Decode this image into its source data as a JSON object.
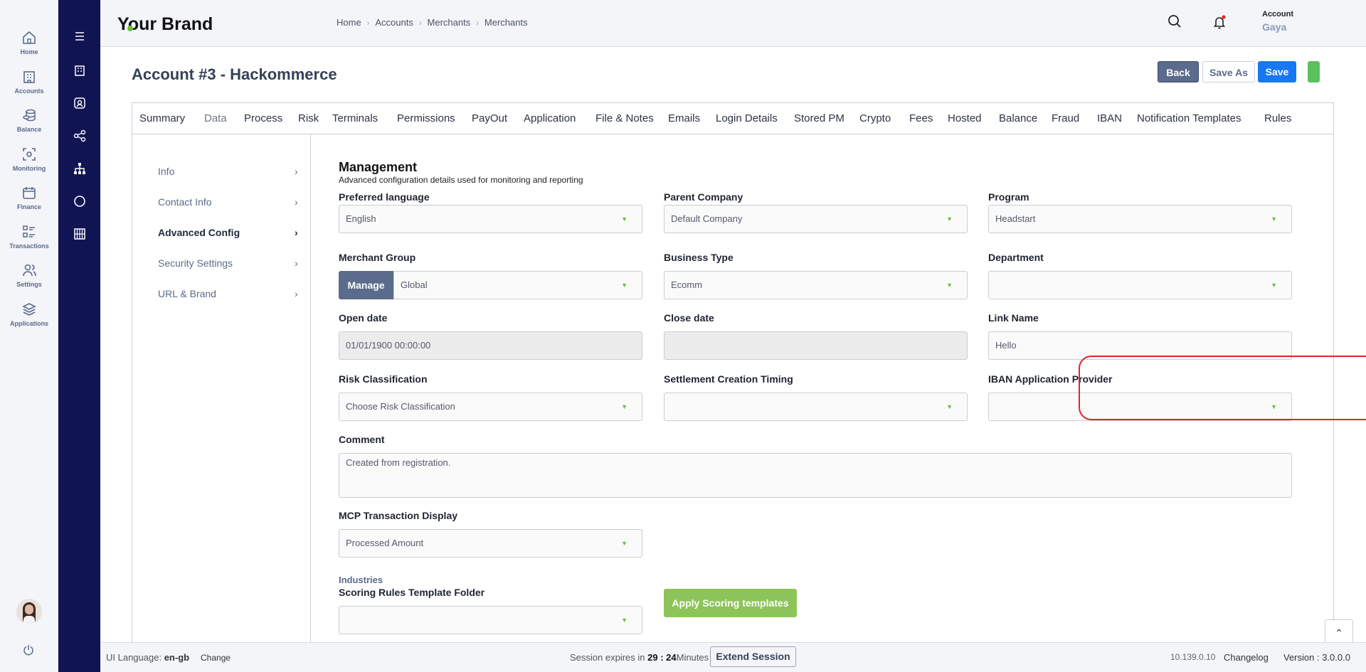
{
  "nav": {
    "items": [
      {
        "label": "Home",
        "icon": "home-icon"
      },
      {
        "label": "Accounts",
        "icon": "building-icon"
      },
      {
        "label": "Balance",
        "icon": "coins-icon"
      },
      {
        "label": "Monitoring",
        "icon": "monitor-icon"
      },
      {
        "label": "Finance",
        "icon": "calendar-icon"
      },
      {
        "label": "Transactions",
        "icon": "list-icon"
      },
      {
        "label": "Settings",
        "icon": "users-icon"
      },
      {
        "label": "Applications",
        "icon": "layers-icon"
      }
    ]
  },
  "header": {
    "brand": "Your Brand",
    "breadcrumb": [
      "Home",
      "Accounts",
      "Merchants",
      "Merchants"
    ],
    "account_label": "Account",
    "account_name": "Gaya"
  },
  "page": {
    "title": "Account #3 - Hackommerce",
    "buttons": {
      "back": "Back",
      "save_as": "Save As",
      "save": "Save"
    }
  },
  "tabs": [
    "Summary",
    "Data",
    "Process",
    "Risk",
    "Terminals",
    "Permissions",
    "PayOut",
    "Application",
    "File & Notes",
    "Emails",
    "Login Details",
    "Stored PM",
    "Crypto",
    "Fees",
    "Hosted",
    "Balance",
    "Fraud",
    "IBAN",
    "Notification Templates",
    "Rules"
  ],
  "subnav": [
    "Info",
    "Contact Info",
    "Advanced Config",
    "Security Settings",
    "URL & Brand"
  ],
  "form": {
    "heading": "Management",
    "subheading": "Advanced configuration details used for monitoring and reporting",
    "preferred_language": {
      "label": "Preferred language",
      "value": "English"
    },
    "parent_company": {
      "label": "Parent Company",
      "value": "Default Company"
    },
    "program": {
      "label": "Program",
      "value": "Headstart"
    },
    "merchant_group": {
      "label": "Merchant Group",
      "manage": "Manage",
      "value": "Global"
    },
    "business_type": {
      "label": "Business Type",
      "value": "Ecomm"
    },
    "department": {
      "label": "Department",
      "value": ""
    },
    "open_date": {
      "label": "Open date",
      "value": "01/01/1900 00:00:00"
    },
    "close_date": {
      "label": "Close date",
      "value": ""
    },
    "link_name": {
      "label": "Link Name",
      "value": "Hello"
    },
    "risk_classification": {
      "label": "Risk Classification",
      "value": "Choose Risk Classification"
    },
    "settlement_timing": {
      "label": "Settlement Creation Timing",
      "value": ""
    },
    "iban_provider": {
      "label": "IBAN Application Provider",
      "value": ""
    },
    "comment": {
      "label": "Comment",
      "value": "Created from registration."
    },
    "mcp_display": {
      "label": "MCP Transaction Display",
      "value": "Processed Amount"
    },
    "industries": "Industries",
    "scoring_folder": {
      "label": "Scoring Rules Template Folder",
      "value": ""
    },
    "apply_scoring": "Apply Scoring templates"
  },
  "footer": {
    "ui_language_label": "UI Language:",
    "ui_language": "en-gb",
    "change": "Change",
    "session_prefix": "Session expires in",
    "session_time": "29 : 24",
    "session_suffix": "Minutes",
    "extend": "Extend Session",
    "ip": "10.139.0.10",
    "changelog": "Changelog",
    "version": "Version : 3.0.0.0"
  },
  "colors": {
    "sidebar": "#111453",
    "accent": "#1877f2",
    "green": "#6cbf3c",
    "highlight": "#e0262a"
  }
}
